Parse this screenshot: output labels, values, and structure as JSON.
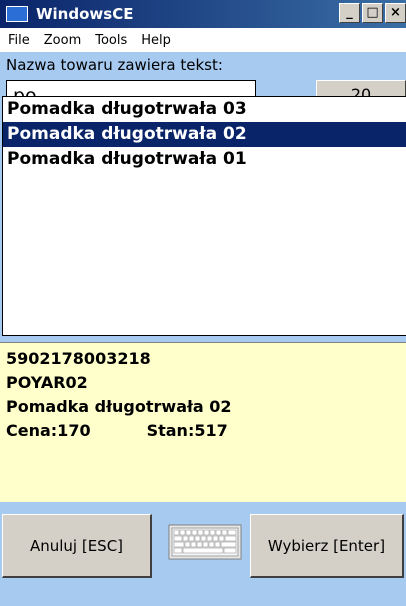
{
  "window": {
    "title": "WindowsCE",
    "min": "_",
    "max": "□",
    "close": "×"
  },
  "menu": [
    "File",
    "Zoom",
    "Tools",
    "Help"
  ],
  "search": {
    "label": "Nazwa towaru zawiera tekst:",
    "value": "po"
  },
  "count_button": "20",
  "list": {
    "items": [
      "Pomadka długotrwała 03",
      "Pomadka długotrwała 02",
      "Pomadka długotrwała 01"
    ],
    "selected_index": 1
  },
  "details": {
    "barcode": "5902178003218",
    "code": "POYAR02",
    "name": "Pomadka długotrwała 02",
    "price": "Cena:170",
    "stock": "Stan:517"
  },
  "buttons": {
    "cancel": "Anuluj [ESC]",
    "select": "Wybierz [Enter]"
  },
  "colors": {
    "titlebar": "#0a246a",
    "form_background": "#a6caf0",
    "selection": "#0a246a",
    "details_background": "#ffffcc"
  },
  "icons": {
    "keyboard": "keyboard-icon",
    "app": "windowsce-logo-icon"
  }
}
